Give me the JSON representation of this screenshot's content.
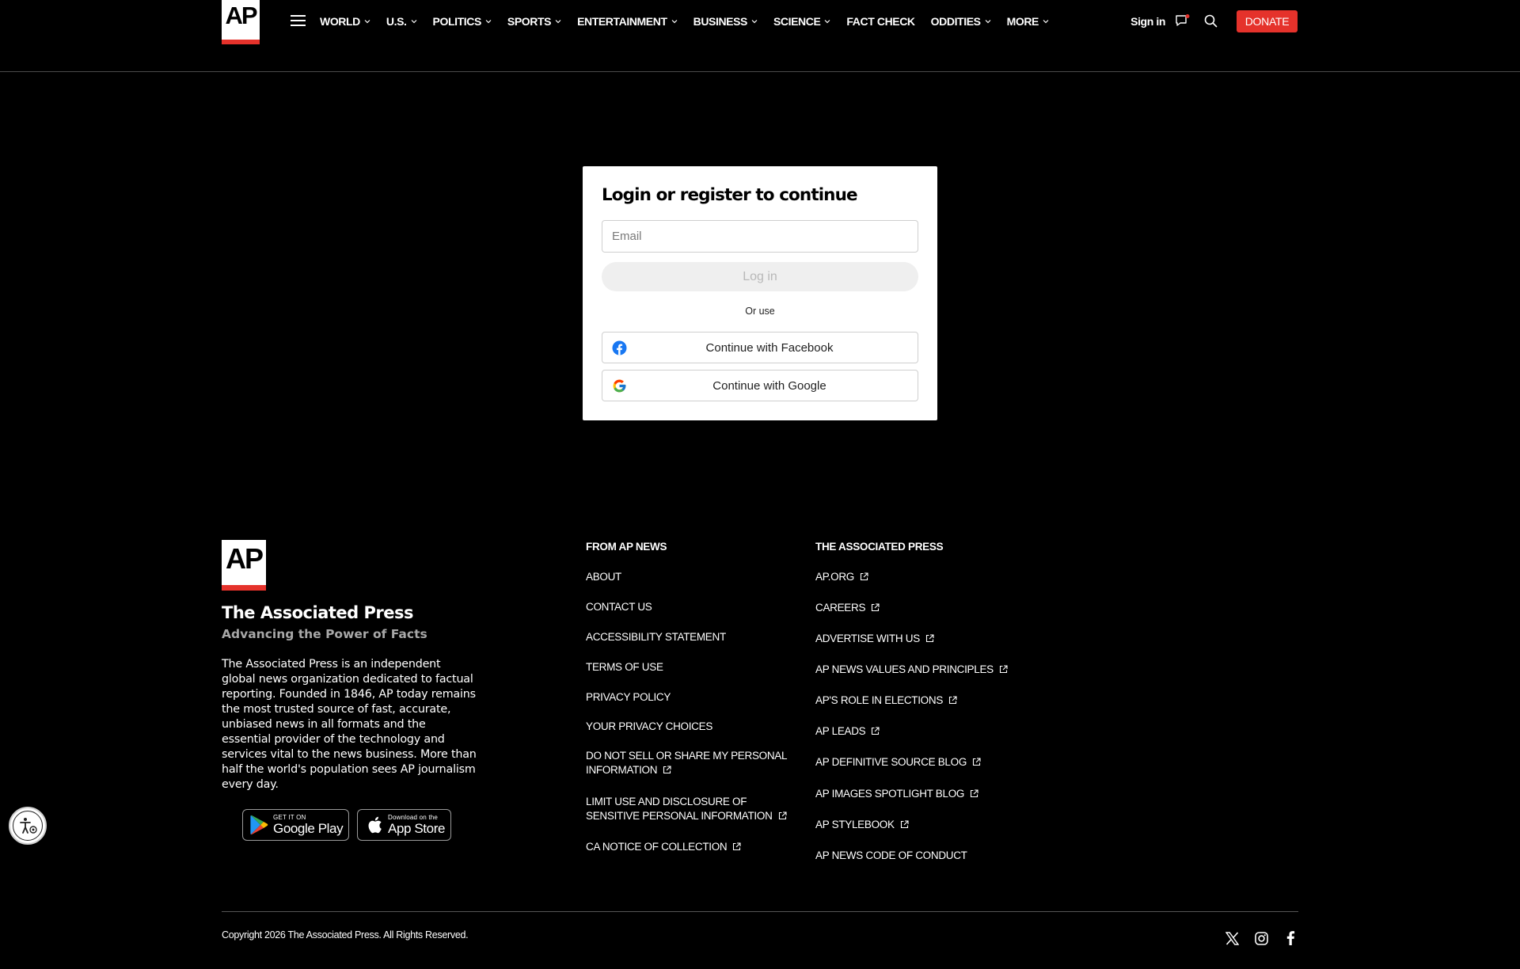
{
  "header": {
    "logo_text": "AP",
    "nav": [
      {
        "label": "WORLD",
        "dropdown": true
      },
      {
        "label": "U.S.",
        "dropdown": true
      },
      {
        "label": "POLITICS",
        "dropdown": true
      },
      {
        "label": "SPORTS",
        "dropdown": true
      },
      {
        "label": "ENTERTAINMENT",
        "dropdown": true
      },
      {
        "label": "BUSINESS",
        "dropdown": true
      },
      {
        "label": "SCIENCE",
        "dropdown": true
      },
      {
        "label": "FACT CHECK",
        "dropdown": false
      },
      {
        "label": "ODDITIES",
        "dropdown": true
      },
      {
        "label": "MORE",
        "dropdown": true
      }
    ],
    "signin": "Sign in",
    "donate": "DONATE",
    "icons": [
      "menu-icon",
      "notification-icon",
      "search-icon"
    ]
  },
  "login": {
    "title": "Login or register to continue",
    "email_placeholder": "Email",
    "login_button": "Log in",
    "or_use": "Or use",
    "facebook": "Continue with Facebook",
    "google": "Continue with Google"
  },
  "footer": {
    "logo_text": "AP",
    "brand": "The Associated Press",
    "tagline": "Advancing the Power of Facts",
    "description": "The Associated Press is an independent global news organization dedicated to factual reporting. Founded in 1846, AP today remains the most trusted source of fast, accurate, unbiased news in all formats and the essential provider of the technology and services vital to the news business. More than half the world's population sees AP journalism every day.",
    "google_play": {
      "small": "GET IT ON",
      "big": "Google Play"
    },
    "app_store": {
      "small": "Download on the",
      "big": "App Store"
    },
    "col1": {
      "heading": "FROM AP NEWS",
      "links": [
        {
          "label": "ABOUT",
          "ext": false
        },
        {
          "label": "CONTACT US",
          "ext": false
        },
        {
          "label": "ACCESSIBILITY STATEMENT",
          "ext": false
        },
        {
          "label": "TERMS OF USE",
          "ext": false
        },
        {
          "label": "PRIVACY POLICY",
          "ext": false
        },
        {
          "label": "YOUR PRIVACY CHOICES",
          "ext": false
        },
        {
          "label": "DO NOT SELL OR SHARE MY PERSONAL INFORMATION",
          "ext": true
        },
        {
          "label": "LIMIT USE AND DISCLOSURE OF SENSITIVE PERSONAL INFORMATION",
          "ext": true
        },
        {
          "label": "CA NOTICE OF COLLECTION",
          "ext": true
        }
      ]
    },
    "col2": {
      "heading": "THE ASSOCIATED PRESS",
      "links": [
        {
          "label": "AP.ORG",
          "ext": true
        },
        {
          "label": "CAREERS",
          "ext": true
        },
        {
          "label": "ADVERTISE WITH US",
          "ext": true
        },
        {
          "label": "AP NEWS VALUES AND PRINCIPLES",
          "ext": true
        },
        {
          "label": "AP'S ROLE IN ELECTIONS",
          "ext": true
        },
        {
          "label": "AP LEADS",
          "ext": true
        },
        {
          "label": "AP DEFINITIVE SOURCE BLOG",
          "ext": true
        },
        {
          "label": "AP IMAGES SPOTLIGHT BLOG",
          "ext": true
        },
        {
          "label": "AP STYLEBOOK",
          "ext": true
        },
        {
          "label": "AP NEWS CODE OF CONDUCT",
          "ext": false
        }
      ]
    },
    "copyright": "Copyright 2026 The Associated Press. All Rights Reserved.",
    "social_icons": [
      "x-icon",
      "instagram-icon",
      "facebook-icon"
    ]
  },
  "colors": {
    "accent": "#e5322b",
    "background": "#000000",
    "card": "#ffffff"
  }
}
